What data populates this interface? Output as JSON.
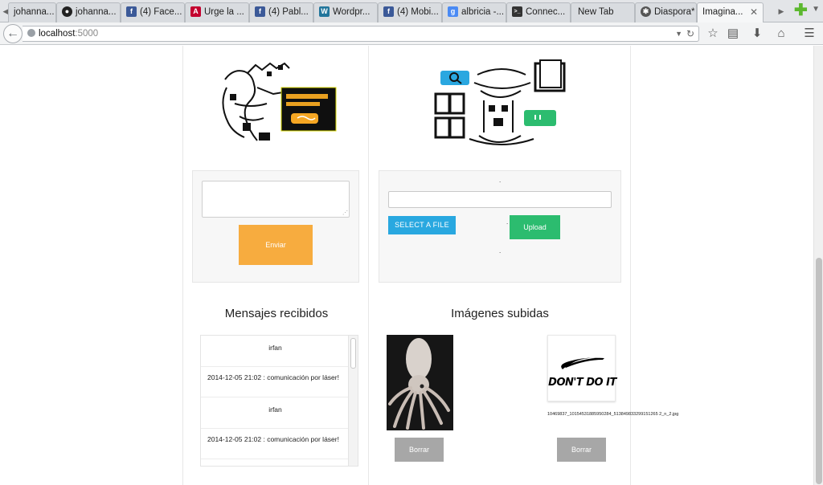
{
  "browser": {
    "tabs": [
      {
        "label": "johanna...",
        "icon": "tab-partial-icon"
      },
      {
        "label": "johanna...",
        "icon": "github-icon"
      },
      {
        "label": "(4) Face...",
        "icon": "facebook-icon"
      },
      {
        "label": "Urge la ...",
        "icon": "angular-icon"
      },
      {
        "label": "(4) Pabl...",
        "icon": "facebook-icon"
      },
      {
        "label": "Wordpr...",
        "icon": "wordpress-icon"
      },
      {
        "label": "(4) Mobi...",
        "icon": "facebook-icon"
      },
      {
        "label": "albricia -...",
        "icon": "google-icon"
      },
      {
        "label": "Connec...",
        "icon": "terminal-icon"
      },
      {
        "label": "New Tab",
        "icon": ""
      },
      {
        "label": "Diaspora*",
        "icon": "diaspora-icon"
      },
      {
        "label": "Imagina...",
        "icon": "",
        "active": true
      }
    ],
    "url_host": "localhost",
    "url_port": ":5000"
  },
  "page": {
    "send_button": "Enviar",
    "select_file_button": "SELECT A FILE",
    "upload_button": "Upload",
    "dot_marker": ".",
    "messages_title": "Mensajes recibidos",
    "images_title": "Imágenes subidas",
    "messages": [
      {
        "author": "irfan",
        "text": "2014-12-05 21:02 : comunicación por láser!"
      },
      {
        "author": "irfan",
        "text": "2014-12-05 21:02 : comunicación por láser!"
      }
    ],
    "images": [
      {
        "caption": "",
        "delete_label": "Borrar"
      },
      {
        "caption": "10469837_10154531885950284_513849833299151265 2_n_2.jpg",
        "delete_label": "Borrar",
        "logo_text": "DON'T DO IT"
      }
    ]
  },
  "colors": {
    "send": "#f7ac3f",
    "select_file": "#29a8e0",
    "upload": "#2cbc6f",
    "borrar": "#a7a7a7"
  }
}
